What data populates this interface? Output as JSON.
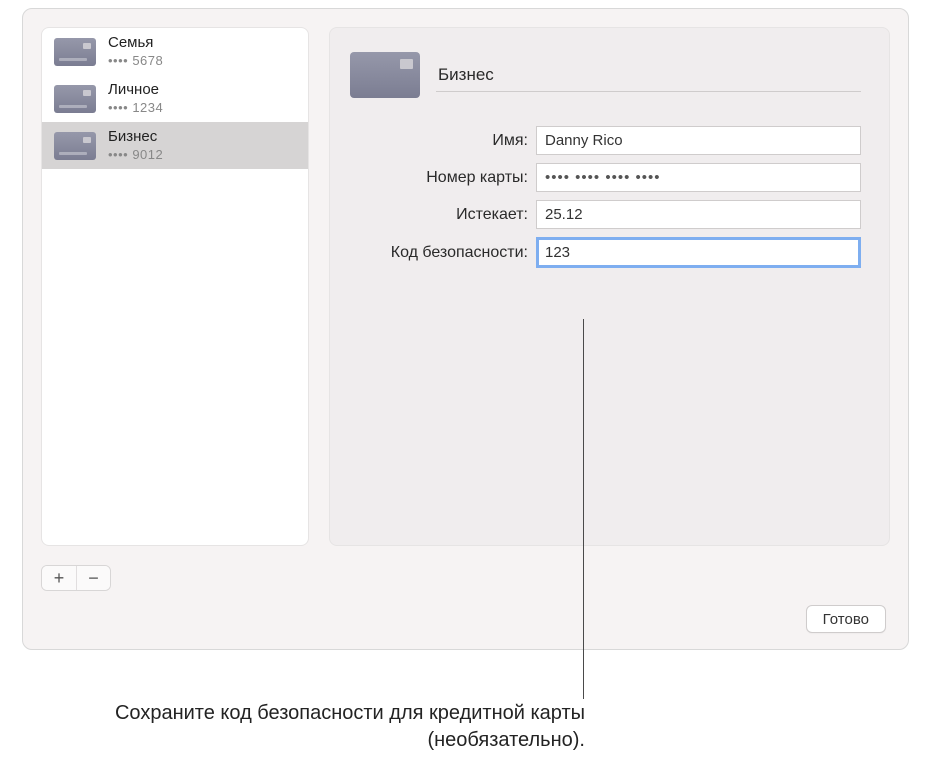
{
  "sidebar": {
    "items": [
      {
        "title": "Семья",
        "subtitle": "•••• 5678"
      },
      {
        "title": "Личное",
        "subtitle": "•••• 1234"
      },
      {
        "title": "Бизнес",
        "subtitle": "•••• 9012"
      }
    ],
    "selected_index": 2
  },
  "detail": {
    "title_value": "Бизнес",
    "fields": {
      "name": {
        "label": "Имя:",
        "value": "Danny Rico"
      },
      "number": {
        "label": "Номер карты:",
        "value": "•••• •••• •••• ••••"
      },
      "expires": {
        "label": "Истекает:",
        "value": "25.12"
      },
      "security": {
        "label": "Код безопасности:",
        "value": "123"
      }
    }
  },
  "toolbar": {
    "add": "+",
    "remove": "−"
  },
  "done_button": "Готово",
  "callout": "Сохраните код безопасности для кредитной карты (необязательно)."
}
